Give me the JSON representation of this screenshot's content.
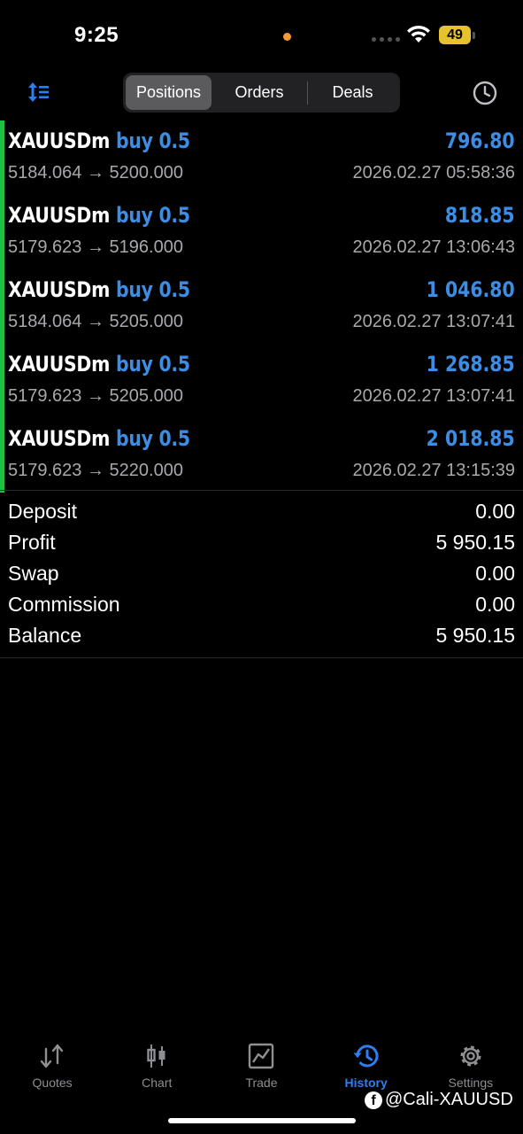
{
  "status_bar": {
    "time": "9:25",
    "battery": "49"
  },
  "header": {
    "segments": [
      {
        "label": "Positions",
        "active": true
      },
      {
        "label": "Orders",
        "active": false
      },
      {
        "label": "Deals",
        "active": false
      }
    ],
    "sort_icon": "sort-icon",
    "history_icon": "clock-icon"
  },
  "deals": [
    {
      "symbol": "XAUUSDm",
      "direction": "buy 0.5",
      "profit": "796.80",
      "prices": "5184.064 → 5200.000",
      "time": "2026.02.27 05:58:36"
    },
    {
      "symbol": "XAUUSDm",
      "direction": "buy 0.5",
      "profit": "818.85",
      "prices": "5179.623 → 5196.000",
      "time": "2026.02.27 13:06:43"
    },
    {
      "symbol": "XAUUSDm",
      "direction": "buy 0.5",
      "profit": "1 046.80",
      "prices": "5184.064 → 5205.000",
      "time": "2026.02.27 13:07:41"
    },
    {
      "symbol": "XAUUSDm",
      "direction": "buy 0.5",
      "profit": "1 268.85",
      "prices": "5179.623 → 5205.000",
      "time": "2026.02.27 13:07:41"
    },
    {
      "symbol": "XAUUSDm",
      "direction": "buy 0.5",
      "profit": "2 018.85",
      "prices": "5179.623 → 5220.000",
      "time": "2026.02.27 13:15:39"
    }
  ],
  "summary": [
    {
      "label": "Deposit",
      "value": "0.00"
    },
    {
      "label": "Profit",
      "value": "5 950.15"
    },
    {
      "label": "Swap",
      "value": "0.00"
    },
    {
      "label": "Commission",
      "value": "0.00"
    },
    {
      "label": "Balance",
      "value": "5 950.15"
    }
  ],
  "tabbar": [
    {
      "label": "Quotes",
      "icon": "quotes-icon",
      "active": false
    },
    {
      "label": "Chart",
      "icon": "chart-icon",
      "active": false
    },
    {
      "label": "Trade",
      "icon": "trade-icon",
      "active": false
    },
    {
      "label": "History",
      "icon": "history-icon",
      "active": true
    },
    {
      "label": "Settings",
      "icon": "settings-icon",
      "active": false
    }
  ],
  "watermark": "@Cali-XAUUSD",
  "colors": {
    "accent": "#3b8de6",
    "buy_bar": "#1fbf44",
    "tab_active": "#2e7ef0",
    "battery": "#e6c32e"
  }
}
